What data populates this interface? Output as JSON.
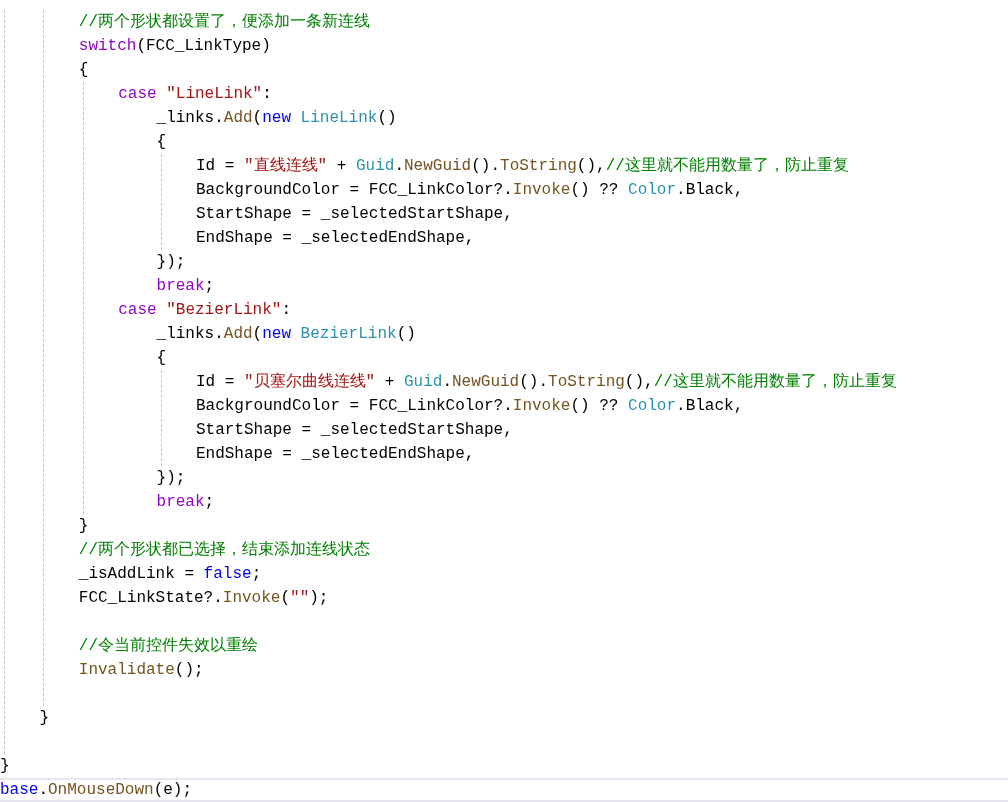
{
  "editor": {
    "lines": [
      {
        "kind": "guided_block",
        "children": [
          {
            "kind": "guided_block",
            "children": [
              {
                "kind": "line",
                "tokens": [
                  {
                    "kind": "comment",
                    "text": "//两个形状都设置了，便添加一条新连线"
                  }
                ]
              },
              {
                "kind": "line",
                "tokens": [
                  {
                    "kind": "control",
                    "text": "switch"
                  },
                  {
                    "kind": "plain",
                    "text": "(FCC_LinkType)"
                  }
                ]
              },
              {
                "kind": "line",
                "tokens": [
                  {
                    "kind": "plain",
                    "text": "{"
                  }
                ]
              },
              {
                "kind": "guided_block",
                "children": [
                  {
                    "kind": "line",
                    "tokens": [
                      {
                        "kind": "control",
                        "text": "case "
                      },
                      {
                        "kind": "string",
                        "text": "\"LineLink\""
                      },
                      {
                        "kind": "plain",
                        "text": ":"
                      }
                    ]
                  },
                  {
                    "kind": "plain_block",
                    "children": [
                      {
                        "kind": "line",
                        "tokens": [
                          {
                            "kind": "plain",
                            "text": "_links."
                          },
                          {
                            "kind": "method",
                            "text": "Add"
                          },
                          {
                            "kind": "plain",
                            "text": "("
                          },
                          {
                            "kind": "keyword",
                            "text": "new "
                          },
                          {
                            "kind": "type",
                            "text": "LineLink"
                          },
                          {
                            "kind": "plain",
                            "text": "()"
                          }
                        ]
                      },
                      {
                        "kind": "line",
                        "tokens": [
                          {
                            "kind": "plain",
                            "text": "{"
                          }
                        ]
                      },
                      {
                        "kind": "guided_block",
                        "children": [
                          {
                            "kind": "line",
                            "tokens": [
                              {
                                "kind": "plain",
                                "text": "Id = "
                              },
                              {
                                "kind": "string",
                                "text": "\"直线连线\""
                              },
                              {
                                "kind": "plain",
                                "text": " + "
                              },
                              {
                                "kind": "type",
                                "text": "Guid"
                              },
                              {
                                "kind": "plain",
                                "text": "."
                              },
                              {
                                "kind": "method",
                                "text": "NewGuid"
                              },
                              {
                                "kind": "plain",
                                "text": "()."
                              },
                              {
                                "kind": "method",
                                "text": "ToString"
                              },
                              {
                                "kind": "plain",
                                "text": "(),"
                              },
                              {
                                "kind": "comment",
                                "text": "//这里就不能用数量了，防止重复"
                              }
                            ]
                          },
                          {
                            "kind": "line",
                            "tokens": [
                              {
                                "kind": "plain",
                                "text": "BackgroundColor = FCC_LinkColor?."
                              },
                              {
                                "kind": "method",
                                "text": "Invoke"
                              },
                              {
                                "kind": "plain",
                                "text": "() ?? "
                              },
                              {
                                "kind": "type",
                                "text": "Color"
                              },
                              {
                                "kind": "plain",
                                "text": ".Black,"
                              }
                            ]
                          },
                          {
                            "kind": "line",
                            "tokens": [
                              {
                                "kind": "plain",
                                "text": "StartShape = _selectedStartShape,"
                              }
                            ]
                          },
                          {
                            "kind": "line",
                            "tokens": [
                              {
                                "kind": "plain",
                                "text": "EndShape = _selectedEndShape,"
                              }
                            ]
                          }
                        ]
                      },
                      {
                        "kind": "line",
                        "tokens": [
                          {
                            "kind": "plain",
                            "text": "});"
                          }
                        ]
                      },
                      {
                        "kind": "line",
                        "tokens": [
                          {
                            "kind": "control",
                            "text": "break"
                          },
                          {
                            "kind": "plain",
                            "text": ";"
                          }
                        ]
                      }
                    ]
                  },
                  {
                    "kind": "line",
                    "tokens": [
                      {
                        "kind": "control",
                        "text": "case "
                      },
                      {
                        "kind": "string",
                        "text": "\"BezierLink\""
                      },
                      {
                        "kind": "plain",
                        "text": ":"
                      }
                    ]
                  },
                  {
                    "kind": "plain_block",
                    "children": [
                      {
                        "kind": "line",
                        "tokens": [
                          {
                            "kind": "plain",
                            "text": "_links."
                          },
                          {
                            "kind": "method",
                            "text": "Add"
                          },
                          {
                            "kind": "plain",
                            "text": "("
                          },
                          {
                            "kind": "keyword",
                            "text": "new "
                          },
                          {
                            "kind": "type",
                            "text": "BezierLink"
                          },
                          {
                            "kind": "plain",
                            "text": "()"
                          }
                        ]
                      },
                      {
                        "kind": "line",
                        "tokens": [
                          {
                            "kind": "plain",
                            "text": "{"
                          }
                        ]
                      },
                      {
                        "kind": "guided_block",
                        "children": [
                          {
                            "kind": "line",
                            "tokens": [
                              {
                                "kind": "plain",
                                "text": "Id = "
                              },
                              {
                                "kind": "string",
                                "text": "\"贝塞尔曲线连线\""
                              },
                              {
                                "kind": "plain",
                                "text": " + "
                              },
                              {
                                "kind": "type",
                                "text": "Guid"
                              },
                              {
                                "kind": "plain",
                                "text": "."
                              },
                              {
                                "kind": "method",
                                "text": "NewGuid"
                              },
                              {
                                "kind": "plain",
                                "text": "()."
                              },
                              {
                                "kind": "method",
                                "text": "ToString"
                              },
                              {
                                "kind": "plain",
                                "text": "(),"
                              },
                              {
                                "kind": "comment",
                                "text": "//这里就不能用数量了，防止重复"
                              }
                            ]
                          },
                          {
                            "kind": "line",
                            "tokens": [
                              {
                                "kind": "plain",
                                "text": "BackgroundColor = FCC_LinkColor?."
                              },
                              {
                                "kind": "method",
                                "text": "Invoke"
                              },
                              {
                                "kind": "plain",
                                "text": "() ?? "
                              },
                              {
                                "kind": "type",
                                "text": "Color"
                              },
                              {
                                "kind": "plain",
                                "text": ".Black,"
                              }
                            ]
                          },
                          {
                            "kind": "line",
                            "tokens": [
                              {
                                "kind": "plain",
                                "text": "StartShape = _selectedStartShape,"
                              }
                            ]
                          },
                          {
                            "kind": "line",
                            "tokens": [
                              {
                                "kind": "plain",
                                "text": "EndShape = _selectedEndShape,"
                              }
                            ]
                          }
                        ]
                      },
                      {
                        "kind": "line",
                        "tokens": [
                          {
                            "kind": "plain",
                            "text": "});"
                          }
                        ]
                      },
                      {
                        "kind": "line",
                        "tokens": [
                          {
                            "kind": "control",
                            "text": "break"
                          },
                          {
                            "kind": "plain",
                            "text": ";"
                          }
                        ]
                      }
                    ]
                  }
                ]
              },
              {
                "kind": "line",
                "tokens": [
                  {
                    "kind": "plain",
                    "text": "}"
                  }
                ]
              },
              {
                "kind": "line",
                "tokens": [
                  {
                    "kind": "comment",
                    "text": "//两个形状都已选择，结束添加连线状态"
                  }
                ]
              },
              {
                "kind": "line",
                "tokens": [
                  {
                    "kind": "plain",
                    "text": "_isAddLink = "
                  },
                  {
                    "kind": "keyword",
                    "text": "false"
                  },
                  {
                    "kind": "plain",
                    "text": ";"
                  }
                ]
              },
              {
                "kind": "line",
                "tokens": [
                  {
                    "kind": "plain",
                    "text": "FCC_LinkState?."
                  },
                  {
                    "kind": "method",
                    "text": "Invoke"
                  },
                  {
                    "kind": "plain",
                    "text": "("
                  },
                  {
                    "kind": "string",
                    "text": "\"\""
                  },
                  {
                    "kind": "plain",
                    "text": ");"
                  }
                ]
              },
              {
                "kind": "blank"
              },
              {
                "kind": "line",
                "tokens": [
                  {
                    "kind": "comment",
                    "text": "//令当前控件失效以重绘"
                  }
                ]
              },
              {
                "kind": "line",
                "tokens": [
                  {
                    "kind": "method",
                    "text": "Invalidate"
                  },
                  {
                    "kind": "plain",
                    "text": "();"
                  }
                ]
              },
              {
                "kind": "blank"
              }
            ]
          },
          {
            "kind": "line",
            "tokens": [
              {
                "kind": "plain",
                "text": "}"
              }
            ]
          },
          {
            "kind": "blank"
          }
        ]
      },
      {
        "kind": "line",
        "tokens": [
          {
            "kind": "plain",
            "text": "}"
          }
        ]
      },
      {
        "kind": "current_line",
        "tokens": [
          {
            "kind": "keyword",
            "text": "base"
          },
          {
            "kind": "plain",
            "text": "."
          },
          {
            "kind": "method",
            "text": "OnMouseDown"
          },
          {
            "kind": "plain",
            "text": "(e);"
          }
        ]
      }
    ]
  }
}
